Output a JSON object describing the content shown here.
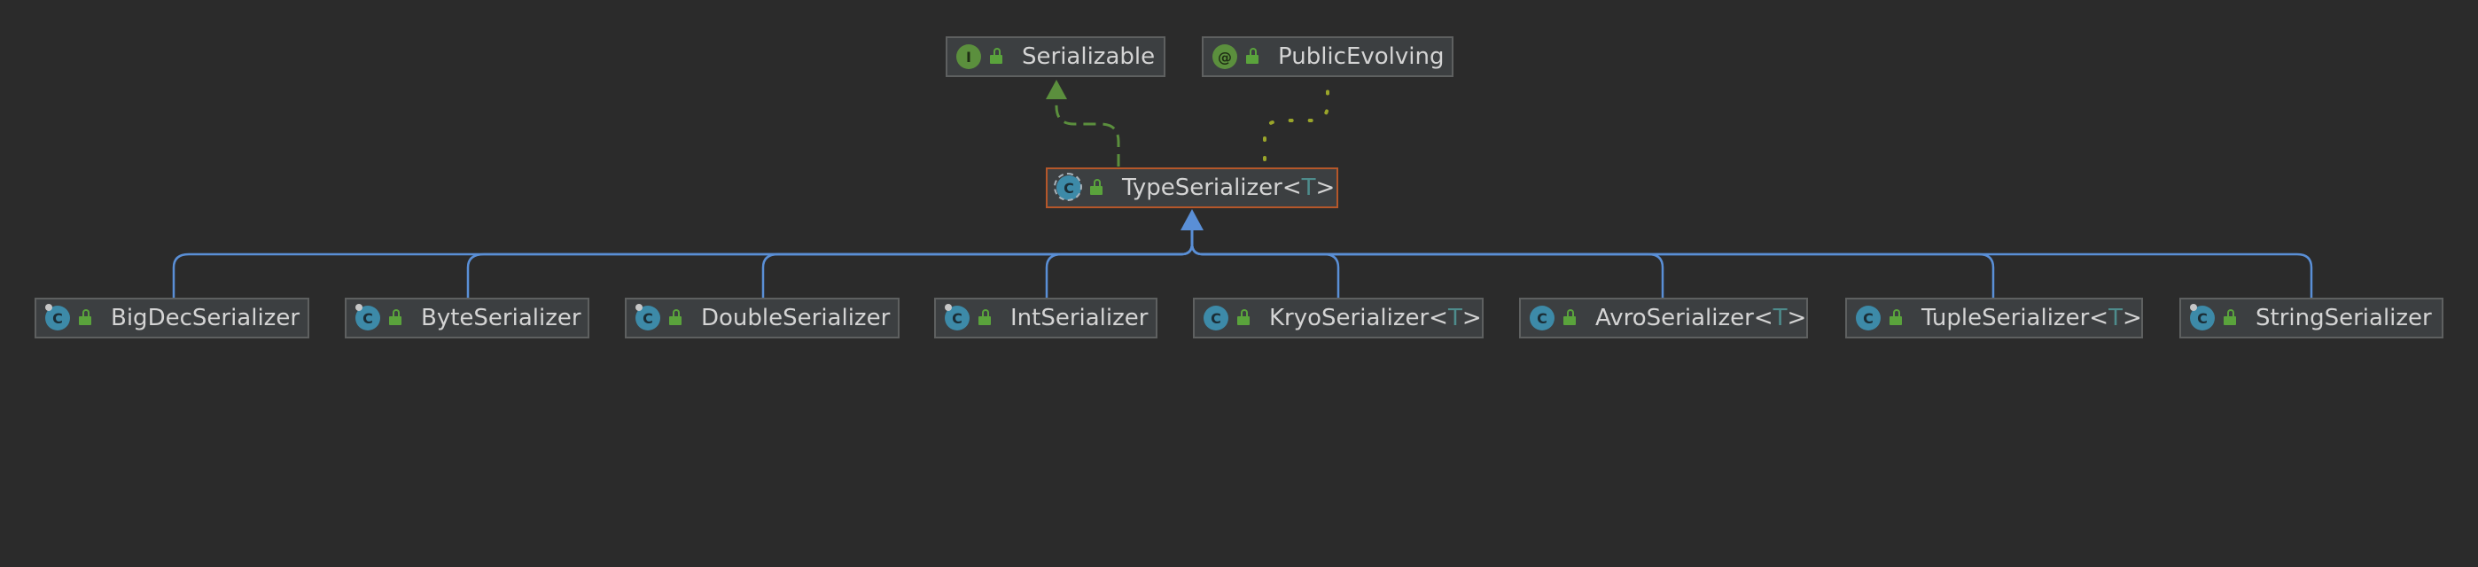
{
  "diagram": {
    "root": {
      "name": "TypeSerializer",
      "type_param": "T"
    },
    "parents": [
      {
        "name": "Serializable",
        "kind": "interface",
        "badge": "I"
      },
      {
        "name": "PublicEvolving",
        "kind": "annotation",
        "badge": "@"
      }
    ],
    "children": [
      {
        "name": "BigDecSerializer",
        "badge": "C"
      },
      {
        "name": "ByteSerializer",
        "badge": "C"
      },
      {
        "name": "DoubleSerializer",
        "badge": "C"
      },
      {
        "name": "IntSerializer",
        "badge": "C"
      },
      {
        "name": "KryoSerializer",
        "badge": "C",
        "type_param": "T"
      },
      {
        "name": "AvroSerializer",
        "badge": "C",
        "type_param": "T"
      },
      {
        "name": "TupleSerializer",
        "badge": "C",
        "type_param": "T"
      },
      {
        "name": "StringSerializer",
        "badge": "C"
      }
    ],
    "colors": {
      "background": "#2b2b2b",
      "implements_edge": "#5b8f3d",
      "annotation_edge": "#9aa52a",
      "extends_edge": "#5a8fd6",
      "selected_border": "#b5572a"
    }
  },
  "lt": "<",
  "gt": ">"
}
